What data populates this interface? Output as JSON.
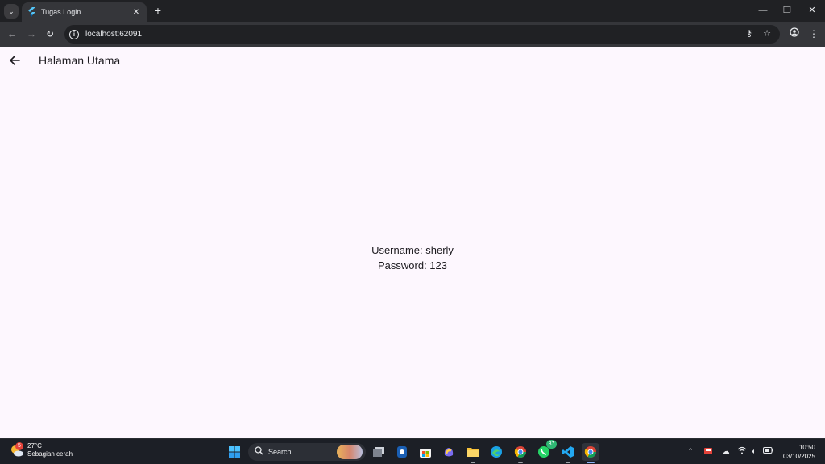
{
  "browser": {
    "tab_title": "Tugas Login",
    "url": "localhost:62091"
  },
  "app": {
    "title": "Halaman Utama",
    "username_line": "Username: sherly",
    "password_line": "Password: 123"
  },
  "taskbar": {
    "weather_temp": "27°C",
    "weather_desc": "Sebagian cerah",
    "weather_badge": "5",
    "search_label": "Search",
    "whatsapp_badge": "37",
    "time": "10:50",
    "date": "03/10/2025"
  },
  "colors": {
    "app_background": "#fdf7fe",
    "browser_frame": "#202124",
    "toolbar": "#35363a",
    "taskbar": "#1c1f26"
  }
}
